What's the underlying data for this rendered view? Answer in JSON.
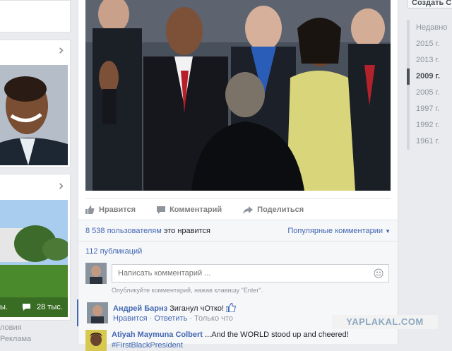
{
  "left_column": {
    "photo_card_count_1": "ы.",
    "photo_card_count_2": "28 тыс.",
    "footer_line1": "ловия",
    "footer_line2": "Реклама"
  },
  "post": {
    "actions": {
      "like": "Нравится",
      "comment": "Комментарий",
      "share": "Поделиться"
    },
    "likes_count": "8 538 пользователям",
    "likes_suffix": "это нравится",
    "popular_comments": "Популярные комментарии",
    "shares": "112 публикаций",
    "comment_input": {
      "placeholder": "Написать комментарий ...",
      "hint": "Опубликуйте комментарий, нажав клавишу \"Enter\"."
    },
    "comments": [
      {
        "author": "Андрей Барнз",
        "text": "Зиганул чОтко!",
        "like_label": "Нравится",
        "reply_label": "Ответить",
        "time": "Только что"
      },
      {
        "author": "Atiyah Maymuna Colbert",
        "text": "...And the WORLD stood up and cheered!",
        "extra": "#FirstBlackPresident"
      }
    ]
  },
  "right_column": {
    "create_button": "Создать С",
    "timeline": [
      "Недавно",
      "2015 г.",
      "2013 г.",
      "2009 г.",
      "2005 г.",
      "1997 г.",
      "1992 г.",
      "1961 г."
    ],
    "active_index": 3
  },
  "watermark": "YAPLAKAL.COM",
  "colors": {
    "link": "#4267b2",
    "background": "#e9ebee",
    "muted": "#90949c"
  }
}
